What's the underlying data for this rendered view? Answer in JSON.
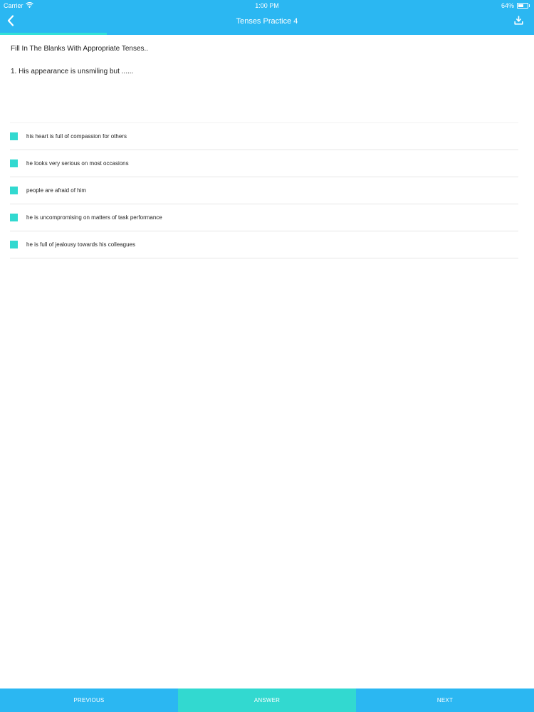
{
  "status_bar": {
    "carrier": "Carrier",
    "time": "1:00 PM",
    "battery": "64%",
    "icons": [
      "wifi-icon",
      "battery-icon"
    ]
  },
  "nav": {
    "title": "Tenses Practice 4",
    "back_icon": "chevron-left-icon",
    "download_icon": "download-icon"
  },
  "progress": 0.2,
  "quiz": {
    "instruction": "Fill In The Blanks With Appropriate Tenses..",
    "question": "1. His appearance is unsmiling but ......",
    "options": [
      "his heart is full of compassion for others",
      "he looks very serious on most occasions",
      "people are afraid of him",
      "he is uncompromising on matters of task performance",
      "he is full of jealousy towards his colleagues"
    ]
  },
  "bottom_bar": {
    "previous": "PREVIOUS",
    "answer": "ANSWER",
    "next": "NEXT"
  },
  "colors": {
    "primary": "#2bb7f2",
    "accent": "#32d9d0",
    "text": "#1f1f1f",
    "divider": "#e6e6e6"
  }
}
